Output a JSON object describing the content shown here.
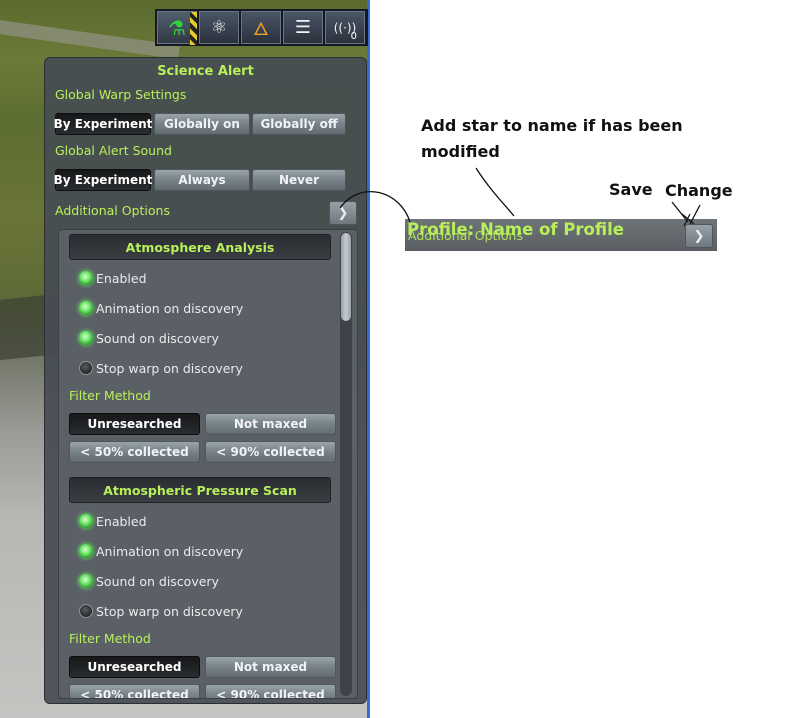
{
  "toolbar": {
    "buttons": [
      {
        "icon": "science-flask-icon",
        "glyph": "⚗",
        "active": true
      },
      {
        "icon": "science-atom-icon",
        "glyph": "⚛"
      },
      {
        "icon": "fuel-flame-icon",
        "glyph": "🜂"
      },
      {
        "icon": "checklist-icon",
        "glyph": "☰"
      },
      {
        "icon": "antenna-icon",
        "glyph": "((·))",
        "badge": "0"
      }
    ]
  },
  "panel": {
    "title": "Science Alert",
    "warp": {
      "label": "Global Warp Settings",
      "options": [
        "By Experiment",
        "Globally on",
        "Globally off"
      ],
      "selected": "By Experiment"
    },
    "sound": {
      "label": "Global Alert Sound",
      "options": [
        "By Experiment",
        "Always",
        "Never"
      ],
      "selected": "By Experiment"
    },
    "additional_options": "Additional Options",
    "experiments": [
      {
        "title": "Atmosphere Analysis",
        "options": [
          {
            "label": "Enabled",
            "on": true
          },
          {
            "label": "Animation on discovery",
            "on": true
          },
          {
            "label": "Sound on discovery",
            "on": true
          },
          {
            "label": "Stop warp on discovery",
            "on": false
          }
        ],
        "filter_label": "Filter Method",
        "filters": [
          "Unresearched",
          "Not maxed",
          "< 50% collected",
          "< 90% collected"
        ],
        "filter_selected": "Unresearched"
      },
      {
        "title": "Atmospheric Pressure Scan",
        "options": [
          {
            "label": "Enabled",
            "on": true
          },
          {
            "label": "Animation on discovery",
            "on": true
          },
          {
            "label": "Sound on discovery",
            "on": true
          },
          {
            "label": "Stop warp on discovery",
            "on": false
          }
        ],
        "filter_label": "Filter Method",
        "filters": [
          "Unresearched",
          "Not maxed",
          "< 50% collected",
          "< 90% collected"
        ],
        "filter_selected": "Unresearched"
      }
    ]
  },
  "annotations": {
    "note_line1": "Add star to name if has been",
    "note_line2": "modified",
    "save": "Save",
    "change": "Change",
    "profile_title": "Profile: Name of Profile",
    "profile_under": "Additional Options"
  },
  "colors": {
    "accent_green": "#b8f05a",
    "led_green": "#6fe46a",
    "panel_bg": "#464c52"
  }
}
